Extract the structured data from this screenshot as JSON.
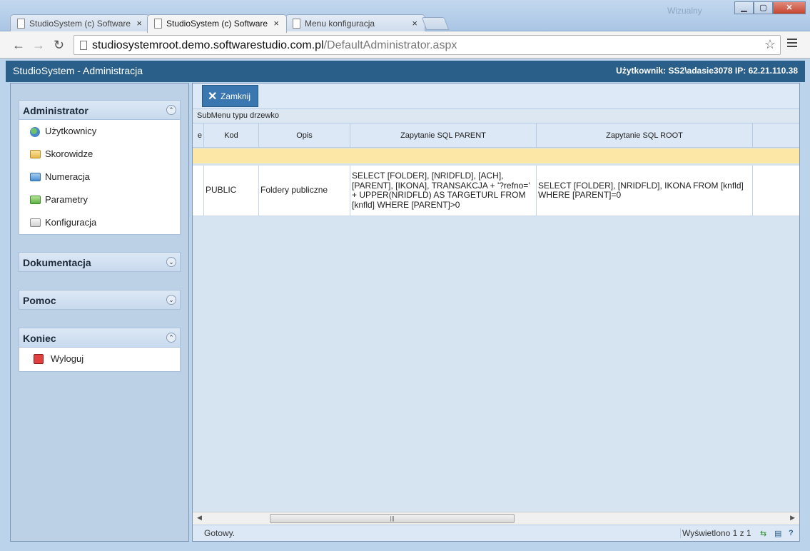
{
  "browser": {
    "tabs": [
      {
        "title": "StudioSystem (c) Software",
        "close": "×"
      },
      {
        "title": "StudioSystem (c) Software",
        "close": "×"
      },
      {
        "title": "Menu konfiguracja",
        "close": "×"
      }
    ],
    "os_user": "Wizualny",
    "url_host": "studiosystemroot.demo.softwarestudio.com.pl",
    "url_path": "/DefaultAdministrator.aspx"
  },
  "app": {
    "title": "StudioSystem - Administracja",
    "user_info": "Użytkownik: SS2\\adasie3078 IP: 62.21.110.38"
  },
  "sidebar": {
    "panels": [
      {
        "title": "Administrator",
        "items": [
          {
            "label": "Użytkownicy",
            "icon": "users-icon"
          },
          {
            "label": "Skorowidze",
            "icon": "folder-yellow-icon"
          },
          {
            "label": "Numeracja",
            "icon": "folder-blue-icon"
          },
          {
            "label": "Parametry",
            "icon": "folder-green-icon"
          },
          {
            "label": "Konfiguracja",
            "icon": "folder-gray-icon"
          }
        ]
      },
      {
        "title": "Dokumentacja",
        "items": []
      },
      {
        "title": "Pomoc",
        "items": []
      },
      {
        "title": "Koniec",
        "items": [
          {
            "label": "Wyloguj",
            "icon": "logout-icon"
          }
        ]
      }
    ]
  },
  "main": {
    "close_button": "Zamknij",
    "caption": "SubMenu typu drzewko",
    "columns": [
      "e",
      "Kod",
      "Opis",
      "Zapytanie SQL PARENT",
      "Zapytanie SQL ROOT"
    ],
    "rows": [
      {
        "kod": "PUBLIC",
        "opis": "Foldery publiczne",
        "sql_parent": "SELECT [FOLDER], [NRIDFLD], [ACH], [PARENT], [IKONA], TRANSAKCJA + '?refno=' + UPPER(NRIDFLD) AS TARGETURL FROM [knfld] WHERE [PARENT]>0",
        "sql_root": "SELECT [FOLDER], [NRIDFLD], IKONA FROM [knfld] WHERE [PARENT]=0"
      }
    ],
    "status_left": "Gotowy.",
    "status_right": "Wyświetlono 1 z 1"
  },
  "colors": {
    "appbar": "#2a5f8a",
    "filter_row": "#fde7a6",
    "sidebar_bg": "#bcd0e6"
  }
}
